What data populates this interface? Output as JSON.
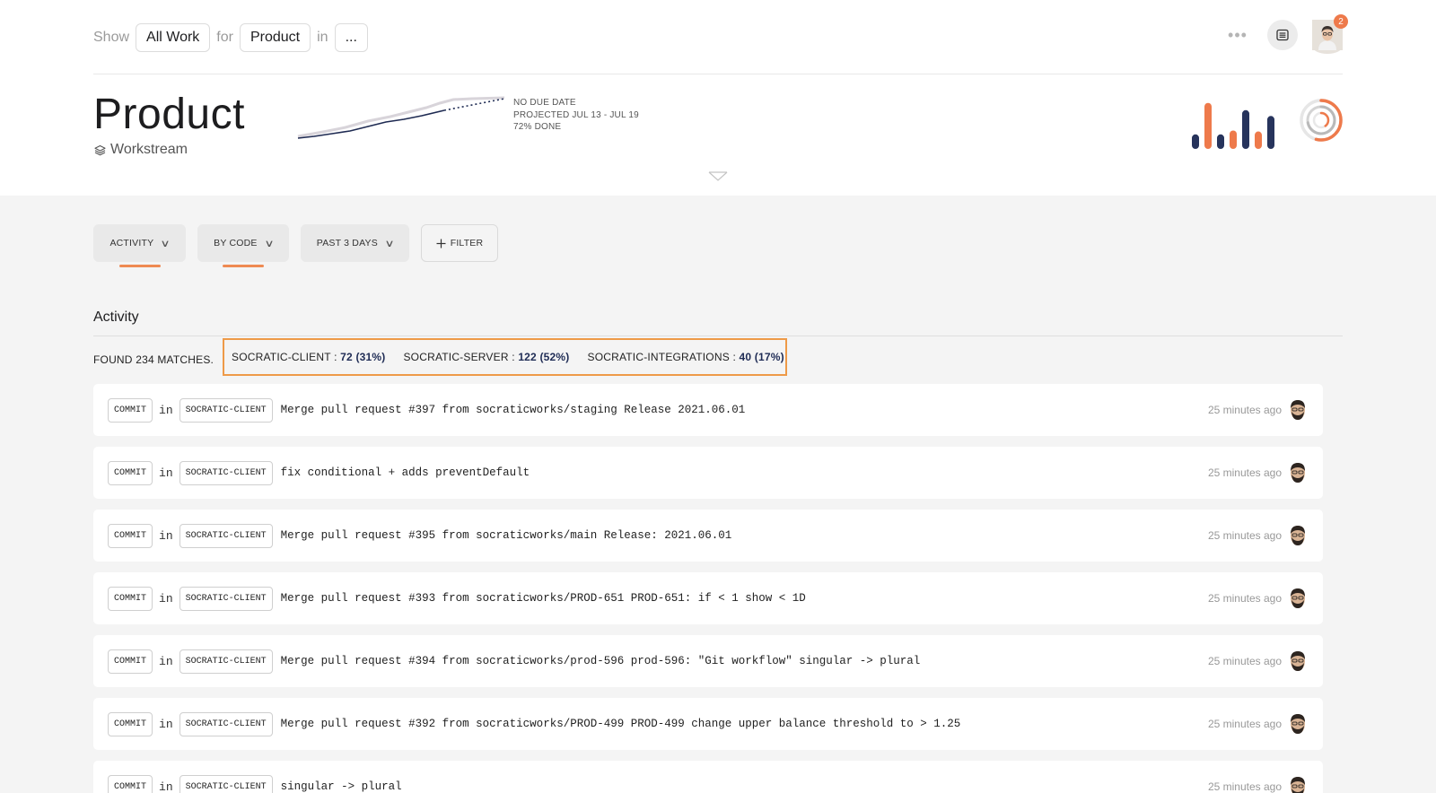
{
  "header": {
    "show_label": "Show",
    "work_value": "All Work",
    "for_label": "for",
    "product_value": "Product",
    "in_label": "in",
    "context_value": "...",
    "more_label": "•••",
    "notification_count": "2"
  },
  "summary": {
    "title": "Product",
    "subtitle": "Workstream",
    "due": "NO DUE DATE",
    "projected": "PROJECTED JUL 13 - JUL 19",
    "done": "72% DONE",
    "done_fraction": 0.72,
    "bar_values": [
      0.3,
      0.95,
      0.3,
      0.38,
      0.8,
      0.36,
      0.68
    ],
    "colors": {
      "accent": "#ee7a4b",
      "navy": "#27345c"
    }
  },
  "filters": [
    {
      "label": "ACTIVITY",
      "active": true
    },
    {
      "label": "BY CODE",
      "active": true
    },
    {
      "label": "PAST 3 DAYS",
      "active": false
    },
    {
      "label": "FILTER",
      "icon": "plus-icon"
    }
  ],
  "activity": {
    "heading": "Activity",
    "matches": "FOUND 234 MATCHES.",
    "repos": [
      {
        "name": "SOCRATIC-CLIENT : ",
        "count": "72 (31%)"
      },
      {
        "name": "SOCRATIC-SERVER : ",
        "count": "122 (52%)"
      },
      {
        "name": "SOCRATIC-INTEGRATIONS : ",
        "count": "40 (17%)"
      }
    ],
    "rows": [
      {
        "type": "COMMIT",
        "in": "in",
        "repo": "SOCRATIC-CLIENT",
        "message": "Merge pull request #397 from socraticworks/staging Release 2021.06.01",
        "time": "25 minutes ago"
      },
      {
        "type": "COMMIT",
        "in": "in",
        "repo": "SOCRATIC-CLIENT",
        "message": "fix conditional + adds preventDefault",
        "time": "25 minutes ago"
      },
      {
        "type": "COMMIT",
        "in": "in",
        "repo": "SOCRATIC-CLIENT",
        "message": "Merge pull request #395 from socraticworks/main Release: 2021.06.01",
        "time": "25 minutes ago"
      },
      {
        "type": "COMMIT",
        "in": "in",
        "repo": "SOCRATIC-CLIENT",
        "message": "Merge pull request #393 from socraticworks/PROD-651 PROD-651: if < 1 show < 1D",
        "time": "25 minutes ago"
      },
      {
        "type": "COMMIT",
        "in": "in",
        "repo": "SOCRATIC-CLIENT",
        "message": "Merge pull request #394 from socraticworks/prod-596 prod-596: \"Git workflow\" singular -> plural",
        "time": "25 minutes ago"
      },
      {
        "type": "COMMIT",
        "in": "in",
        "repo": "SOCRATIC-CLIENT",
        "message": "Merge pull request #392 from socraticworks/PROD-499 PROD-499 change upper balance threshold to > 1.25",
        "time": "25 minutes ago"
      },
      {
        "type": "COMMIT",
        "in": "in",
        "repo": "SOCRATIC-CLIENT",
        "message": "singular -> plural",
        "time": "25 minutes ago"
      }
    ]
  }
}
